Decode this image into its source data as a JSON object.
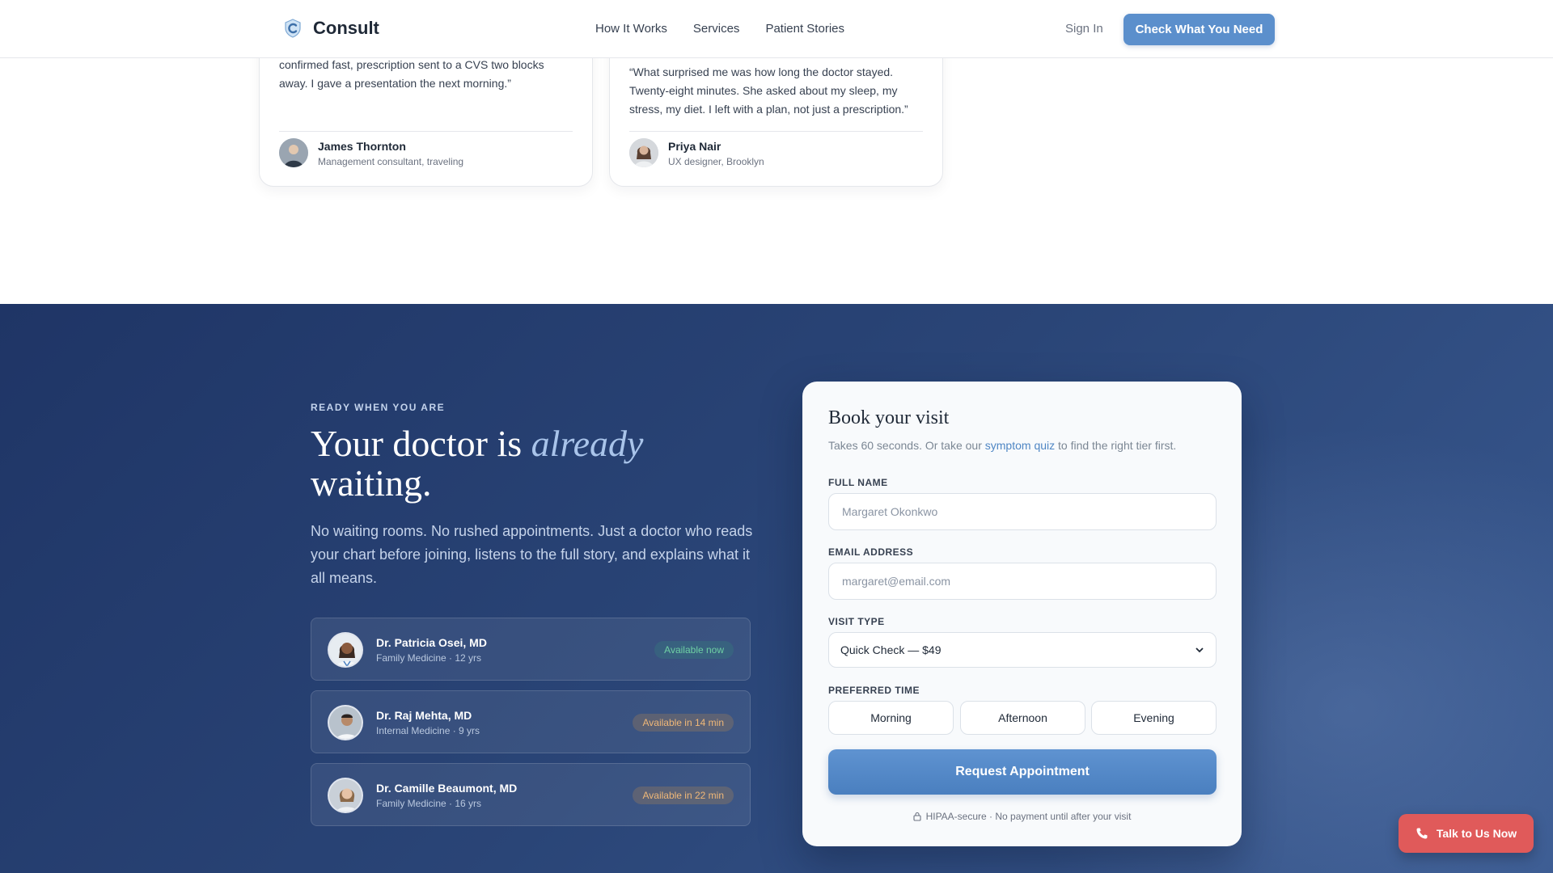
{
  "header": {
    "brand": "Consult",
    "nav": [
      "How It Works",
      "Services",
      "Patient Stories"
    ],
    "sign_in": "Sign In",
    "cta": "Check What You Need"
  },
  "testimonials": [
    {
      "quote": "confirmed fast, prescription sent to a CVS two blocks away. I gave a presentation the next morning.”",
      "name": "James Thornton",
      "role": "Management consultant, traveling"
    },
    {
      "quote": "“What surprised me was how long the doctor stayed. Twenty-eight minutes. She asked about my sleep, my stress, my diet. I left with a plan, not just a prescription.”",
      "name": "Priya Nair",
      "role": "UX designer, Brooklyn"
    }
  ],
  "cta_section": {
    "eyebrow": "READY WHEN YOU ARE",
    "headline_pre": "Your doctor is ",
    "headline_em": "already",
    "headline_post": " waiting.",
    "lead": "No waiting rooms. No rushed appointments. Just a doctor who reads your chart before joining, listens to the full story, and explains what it all means.",
    "doctors": [
      {
        "name": "Dr. Patricia Osei, MD",
        "meta": "Family Medicine · 12 yrs",
        "status": "Available now"
      },
      {
        "name": "Dr. Raj Mehta, MD",
        "meta": "Internal Medicine · 9 yrs",
        "status": "Available in 14 min"
      },
      {
        "name": "Dr. Camille Beaumont, MD",
        "meta": "Family Medicine · 16 yrs",
        "status": "Available in 22 min"
      }
    ]
  },
  "form": {
    "title": "Book your visit",
    "sub_pre": "Takes 60 seconds. Or take our ",
    "sub_link": "symptom quiz",
    "sub_post": " to find the right tier first.",
    "full_name_label": "FULL NAME",
    "full_name_placeholder": "Margaret Okonkwo",
    "email_label": "EMAIL ADDRESS",
    "email_placeholder": "margaret@email.com",
    "visit_type_label": "VISIT TYPE",
    "visit_type_value": "Quick Check — $49",
    "preferred_time_label": "PREFERRED TIME",
    "times": [
      "Morning",
      "Afternoon",
      "Evening"
    ],
    "submit": "Request Appointment",
    "secure_note": "HIPAA-secure · No payment until after your visit"
  },
  "floating": {
    "talk": "Talk to Us Now"
  },
  "colors": {
    "accent": "#5b8fcc",
    "section_bg": "#2a4577",
    "talk_btn": "#e05a5a",
    "available": "#6fd0a4",
    "pending": "#f0b878"
  }
}
